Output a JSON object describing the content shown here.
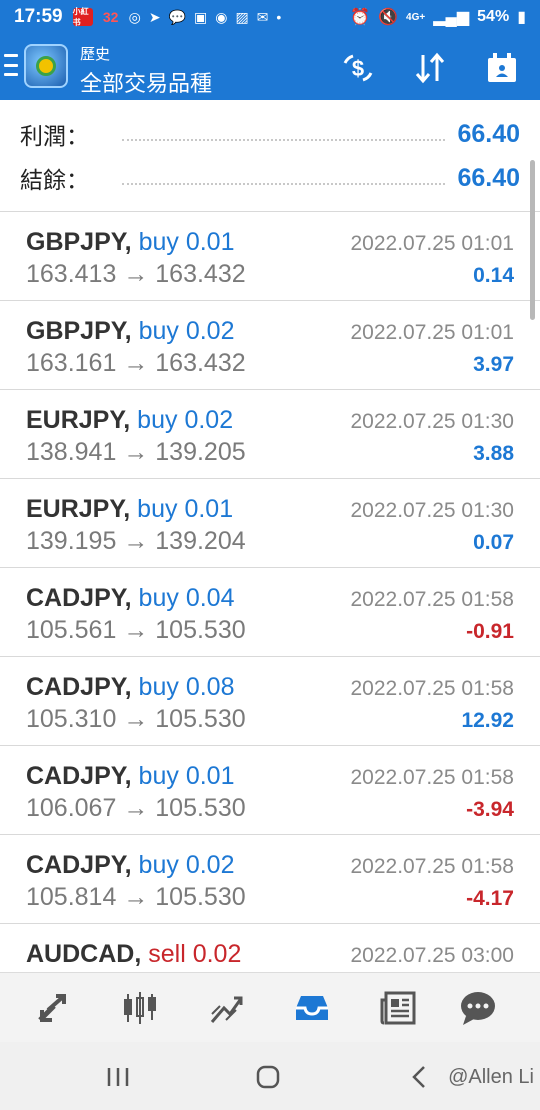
{
  "status_bar": {
    "time": "17:59",
    "left_badges": [
      "小紅书",
      "32"
    ],
    "battery": "54%",
    "network": "4G+"
  },
  "app_bar": {
    "subtitle": "歷史",
    "title": "全部交易品種",
    "icons": [
      "menu-icon",
      "metatrader-logo",
      "currency-exchange-icon",
      "sort-icon",
      "calendar-icon"
    ]
  },
  "summary": {
    "profit_label": "利潤：",
    "profit_value": "66.40",
    "balance_label": "結餘：",
    "balance_value": "66.40"
  },
  "trades": [
    {
      "symbol": "GBPJPY,",
      "side": "buy",
      "volume": "0.01",
      "prices": "163.413 → 163.432",
      "datetime": "2022.07.25 01:01",
      "profit": "0.14"
    },
    {
      "symbol": "GBPJPY,",
      "side": "buy",
      "volume": "0.02",
      "prices": "163.161 → 163.432",
      "datetime": "2022.07.25 01:01",
      "profit": "3.97"
    },
    {
      "symbol": "EURJPY,",
      "side": "buy",
      "volume": "0.02",
      "prices": "138.941 → 139.205",
      "datetime": "2022.07.25 01:30",
      "profit": "3.88"
    },
    {
      "symbol": "EURJPY,",
      "side": "buy",
      "volume": "0.01",
      "prices": "139.195 → 139.204",
      "datetime": "2022.07.25 01:30",
      "profit": "0.07"
    },
    {
      "symbol": "CADJPY,",
      "side": "buy",
      "volume": "0.04",
      "prices": "105.561 → 105.530",
      "datetime": "2022.07.25 01:58",
      "profit": "-0.91"
    },
    {
      "symbol": "CADJPY,",
      "side": "buy",
      "volume": "0.08",
      "prices": "105.310 → 105.530",
      "datetime": "2022.07.25 01:58",
      "profit": "12.92"
    },
    {
      "symbol": "CADJPY,",
      "side": "buy",
      "volume": "0.01",
      "prices": "106.067 → 105.530",
      "datetime": "2022.07.25 01:58",
      "profit": "-3.94"
    },
    {
      "symbol": "CADJPY,",
      "side": "buy",
      "volume": "0.02",
      "prices": "105.814 → 105.530",
      "datetime": "2022.07.25 01:58",
      "profit": "-4.17"
    },
    {
      "symbol": "AUDCAD,",
      "side": "sell",
      "volume": "0.02",
      "prices": "",
      "datetime": "2022.07.25 03:00",
      "profit": ""
    }
  ],
  "bottom_nav": [
    "quotes-icon",
    "chart-icon",
    "trade-icon",
    "history-icon",
    "news-icon",
    "chat-icon"
  ],
  "system_nav": {
    "watermark": "@Allen Li"
  },
  "colors": {
    "accent": "#1d78d4",
    "negative": "#c8262b",
    "text": "#333333",
    "muted": "#8a8a8a"
  }
}
